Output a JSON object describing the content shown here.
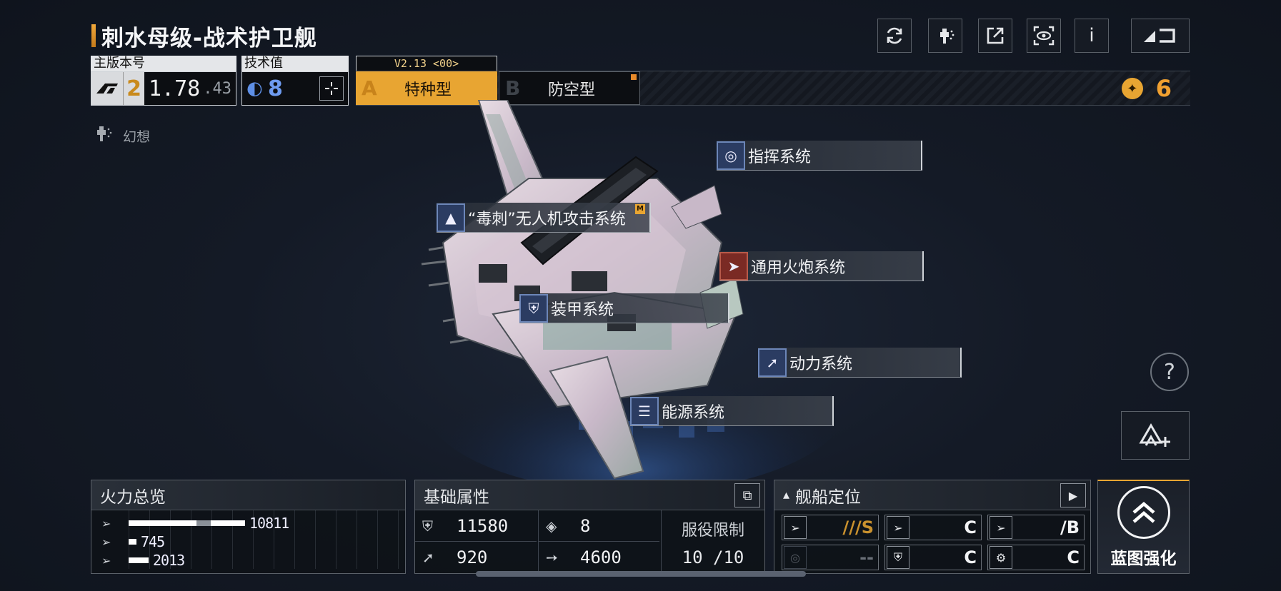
{
  "header": {
    "ship_name": "刺水母级-战术护卫舰"
  },
  "version_box": {
    "label": "主版本号",
    "tier": "2",
    "version": "1.78",
    "sub": ".43"
  },
  "tech_box": {
    "label": "技术值",
    "value": "8",
    "plus_icon": "crosshair-plus-icon"
  },
  "variants": {
    "version_tag": "V2.13 <00>",
    "a": {
      "letter": "A",
      "label": "特种型"
    },
    "b": {
      "letter": "B",
      "label": "防空型"
    }
  },
  "currency": {
    "value": "6"
  },
  "toolbar": {
    "buttons": [
      "refresh-icon",
      "paint-spray-icon",
      "share-icon",
      "view-icon",
      "info-icon",
      "back-icon"
    ],
    "info_text": "i"
  },
  "fantasy": {
    "label": "幻想"
  },
  "systems": {
    "command": "指挥系统",
    "drone": "“毒刺”无人机攻击系统",
    "drone_tag": "M",
    "cannon": "通用火炮系统",
    "armor": "装甲系统",
    "power": "动力系统",
    "energy": "能源系统"
  },
  "firepower": {
    "title": "火力总览",
    "rows": [
      {
        "value": "10811",
        "fraction": 1.0
      },
      {
        "value": "745",
        "fraction": 0.07
      },
      {
        "value": "2013",
        "fraction": 0.19
      }
    ]
  },
  "basic": {
    "title": "基础属性",
    "hp": "11580",
    "armor": "8",
    "speed": "920",
    "range": "4600",
    "service_title": "服役限制",
    "service_value": "10 /10"
  },
  "positioning": {
    "title": "舰船定位",
    "ratings": [
      {
        "grade": "///S",
        "icon": "anti-ship-icon"
      },
      {
        "grade": "C",
        "icon": "anti-fighter-icon"
      },
      {
        "grade": "/B",
        "icon": "siege-icon"
      },
      {
        "grade": "--",
        "icon": "support-icon"
      },
      {
        "grade": "C",
        "icon": "shield-icon"
      },
      {
        "grade": "C",
        "icon": "engineering-icon"
      }
    ]
  },
  "enhance": {
    "label": "蓝图强化"
  },
  "colors": {
    "accent": "#e8a532",
    "background": "#141a26"
  }
}
